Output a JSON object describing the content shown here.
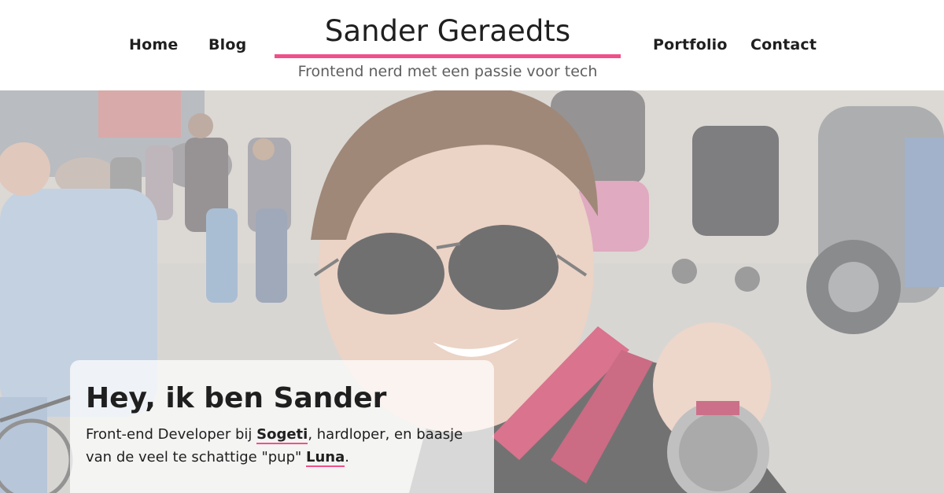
{
  "header": {
    "nav_left": [
      {
        "label": "Home"
      },
      {
        "label": "Blog"
      }
    ],
    "nav_right": [
      {
        "label": "Portfolio"
      },
      {
        "label": "Contact"
      }
    ],
    "site_title": "Sander Geraedts",
    "tagline": "Frontend nerd met een passie voor tech"
  },
  "hero": {
    "photo_icon": "hero-photo",
    "intro": {
      "heading": "Hey, ik ben Sander",
      "text_before_sogeti": "Front-end Developer bij ",
      "sogeti_link": "Sogeti",
      "text_middle": ", hardloper, en baasje van de veel te schattige \"pup\" ",
      "luna_link": "Luna",
      "text_end": "."
    }
  },
  "colors": {
    "accent": "#f0508a",
    "text": "#1f1f1f",
    "tagline": "#5f5f5f"
  }
}
